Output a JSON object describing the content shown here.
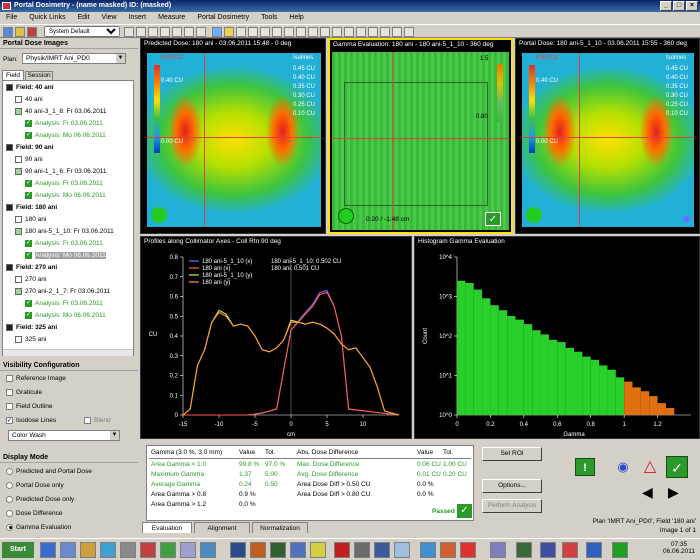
{
  "window": {
    "title": "Portal Dosimetry - (name masked) ID: (masked)"
  },
  "menu": [
    "File",
    "Quick Links",
    "Edit",
    "View",
    "Insert",
    "Measure",
    "Portal Dosimetry",
    "Tools",
    "Help"
  ],
  "toolbar": {
    "mode_value": "System Default"
  },
  "left": {
    "header": "Portal Dose Images",
    "plan_label": "Plan:",
    "plan_value": "Physik/IMRT Ani_PD0",
    "tabs": [
      "Field",
      "Session"
    ],
    "tree": [
      {
        "text": "Field: 40 ani",
        "kind": "field"
      },
      {
        "text": "40 ani",
        "kind": "leaf"
      },
      {
        "text": "40 ani-3_1_8: Fr 03.06.2011",
        "kind": "doc"
      },
      {
        "text": "Analysis: Fr 03.06.2011",
        "kind": "ok"
      },
      {
        "text": "Analysis: Mo 06.06.2011",
        "kind": "ok"
      },
      {
        "text": "Field: 90 ani",
        "kind": "field"
      },
      {
        "text": "90 ani",
        "kind": "leaf"
      },
      {
        "text": "90 ani-1_1_6: Fr 03.06.2011",
        "kind": "doc"
      },
      {
        "text": "Analysis: Fr 03.06.2011",
        "kind": "ok"
      },
      {
        "text": "Analysis: Mo 06.06.2011",
        "kind": "ok"
      },
      {
        "text": "Field: 180 ani",
        "kind": "field"
      },
      {
        "text": "180 ani",
        "kind": "leaf"
      },
      {
        "text": "180 ani-5_1_10: Fr 03.06.2011",
        "kind": "doc"
      },
      {
        "text": "Analysis: Fr 03.06.2011",
        "kind": "ok"
      },
      {
        "text": "Analysis: Mo 06.06.2011",
        "kind": "sel"
      },
      {
        "text": "Field: 270 ani",
        "kind": "field"
      },
      {
        "text": "270 ani",
        "kind": "leaf"
      },
      {
        "text": "270 ani-2_1_7: Fr 03.06.2011",
        "kind": "doc"
      },
      {
        "text": "Analysis: Fr 03.06.2011",
        "kind": "ok"
      },
      {
        "text": "Analysis: Mo 06.06.2011",
        "kind": "ok"
      },
      {
        "text": "Field: 325 ani",
        "kind": "field"
      },
      {
        "text": "325 ani",
        "kind": "leaf"
      }
    ],
    "viz_header": "Visibility Configuration",
    "viz_items": [
      {
        "label": "Reference Image",
        "checked": false
      },
      {
        "label": "Graticule",
        "checked": false
      },
      {
        "label": "Field Outline",
        "checked": false
      },
      {
        "label": "Isodose Lines",
        "checked": true
      },
      {
        "label": "Blend",
        "checked": false
      }
    ],
    "color_mode": "Color Wash",
    "display_header": "Display Mode",
    "display_items": [
      {
        "label": "Predicted and Portal Dose",
        "selected": false
      },
      {
        "label": "Portal Dose only",
        "selected": false
      },
      {
        "label": "Predicted Dose only",
        "selected": false
      },
      {
        "label": "Dose Difference",
        "selected": false
      },
      {
        "label": "Gamma Evaluation",
        "selected": true
      }
    ]
  },
  "viewers": {
    "predicted": {
      "title": "Predicted Dose: 180 ani - 03.06.2011 15:48 - 0 deg",
      "top_value": "0.65 CU",
      "isolines": "Isolines",
      "iso_values": [
        "0.45 CU",
        "0.40 CU",
        "0.35 CU",
        "0.30 CU",
        "0.25 CU",
        "0.10 CU"
      ],
      "l1": "0.40 CU",
      "l2": "0.00 CU"
    },
    "gamma": {
      "title": "Gamma Evaluation: 180 ani - 180 ani-5_1_10 - 360 deg",
      "readout": "0.20 / -1.48 cm",
      "top_value": "1.5",
      "low_value": "0.80"
    },
    "portal": {
      "title": "Portal Dose: 180 ani-5_1_10 - 03.06.2011 15:55 - 360 deg",
      "top_value": "0.65 CU",
      "isolines": "Isolines",
      "iso_values": [
        "0.45 CU",
        "0.40 CU",
        "0.35 CU",
        "0.30 CU",
        "0.25 CU",
        "0.10 CU"
      ],
      "l1": "0.40 CU",
      "l2": "0.00 CU"
    }
  },
  "profile": {
    "title": "Profiles along Collimator Axes - Coll Rtn 90 deg",
    "legend": [
      "180 ani-5_1_10 (x)",
      "180 ani (x)",
      "180 ani-5_1_10 (y)",
      "180 ani (y)"
    ],
    "readout1": "180 ani-5_1_10: 0.502 CU",
    "readout2": "180 ani: 0.501 CU",
    "xlabel": "cm",
    "ylabel": "CU"
  },
  "histogram": {
    "title": "Histogram Gamma Evaluation",
    "xlabel": "Gamma",
    "ylabel": "Count"
  },
  "chart_data": [
    {
      "type": "line",
      "title": "Profiles along Collimator Axes - Coll Rtn 90 deg",
      "xlabel": "cm",
      "ylabel": "CU",
      "xlim": [
        -15,
        15
      ],
      "ylim": [
        0,
        0.8
      ],
      "x_ticks": [
        -15,
        -10,
        -5,
        0,
        5,
        10
      ],
      "y_ticks": [
        0,
        0.1,
        0.2,
        0.3,
        0.4,
        0.5,
        0.6,
        0.7,
        0.8
      ],
      "series": [
        {
          "name": "180 ani-5_1_10 (x)",
          "color": "#7b6cff",
          "x": [
            -15,
            -8,
            -6,
            -4,
            -2,
            0,
            2,
            3,
            4,
            5,
            6,
            7,
            8,
            15
          ],
          "y": [
            0,
            0,
            0,
            0.01,
            0.03,
            0.43,
            0.52,
            0.56,
            0.62,
            0.63,
            0.55,
            0.4,
            0.03,
            0
          ]
        },
        {
          "name": "180 ani (x)",
          "color": "#ff5a50",
          "x": [
            -15,
            -8,
            -6,
            -4,
            -2,
            0,
            2,
            3,
            4,
            5,
            6,
            7,
            8,
            15
          ],
          "y": [
            0,
            0,
            0,
            0.01,
            0.03,
            0.43,
            0.51,
            0.55,
            0.61,
            0.62,
            0.55,
            0.4,
            0.03,
            0
          ]
        },
        {
          "name": "180 ani-5_1_10 (y)",
          "color": "#e0e040",
          "x": [
            -15,
            -14,
            -13,
            -12,
            -11,
            -10,
            -9,
            -8,
            -7,
            -6,
            -5,
            -4,
            -3,
            -2,
            -1,
            0,
            1,
            2,
            3,
            4,
            5,
            6,
            7,
            8,
            9,
            10,
            11,
            12,
            13,
            15
          ],
          "y": [
            0,
            0.03,
            0.25,
            0.33,
            0.47,
            0.53,
            0.51,
            0.45,
            0.46,
            0.45,
            0.4,
            0.33,
            0.32,
            0.34,
            0.38,
            0.48,
            0.47,
            0.46,
            0.47,
            0.46,
            0.44,
            0.41,
            0.36,
            0.33,
            0.34,
            0.29,
            0.24,
            0.14,
            0.02,
            0
          ]
        },
        {
          "name": "180 ani (y)",
          "color": "#ff9a30",
          "x": [
            -15,
            -14,
            -13,
            -12,
            -11,
            -10,
            -9,
            -8,
            -7,
            -6,
            -5,
            -4,
            -3,
            -2,
            -1,
            0,
            1,
            2,
            3,
            4,
            5,
            6,
            7,
            8,
            9,
            10,
            11,
            12,
            13,
            15
          ],
          "y": [
            0,
            0.03,
            0.25,
            0.33,
            0.47,
            0.52,
            0.5,
            0.45,
            0.46,
            0.45,
            0.4,
            0.33,
            0.32,
            0.34,
            0.38,
            0.47,
            0.47,
            0.46,
            0.47,
            0.46,
            0.44,
            0.41,
            0.36,
            0.33,
            0.34,
            0.29,
            0.24,
            0.14,
            0.02,
            0
          ]
        }
      ]
    },
    {
      "type": "bar",
      "title": "Histogram Gamma Evaluation",
      "xlabel": "Gamma",
      "ylabel": "Count",
      "xlim": [
        0,
        1.4
      ],
      "ylim_log": [
        1,
        10000
      ],
      "x_ticks": [
        0,
        0.2,
        0.4,
        0.6,
        0.8,
        1,
        1.2
      ],
      "y_tick_labels": [
        "10^0",
        "10^1",
        "10^2",
        "10^3",
        "10^4"
      ],
      "log_y": true,
      "threshold": 1.0,
      "bins": [
        0.0,
        0.05,
        0.1,
        0.15,
        0.2,
        0.25,
        0.3,
        0.35,
        0.4,
        0.45,
        0.5,
        0.55,
        0.6,
        0.65,
        0.7,
        0.75,
        0.8,
        0.85,
        0.9,
        0.95,
        1.0,
        1.05,
        1.1,
        1.15,
        1.2,
        1.25
      ],
      "counts": [
        2500,
        2200,
        1500,
        900,
        600,
        450,
        320,
        260,
        200,
        140,
        110,
        80,
        70,
        50,
        40,
        30,
        25,
        18,
        14,
        9,
        7,
        5,
        4,
        3,
        2,
        1.5
      ]
    }
  ],
  "results": {
    "headers": [
      "Gamma (3.0 %, 3.0 mm)",
      "Value",
      "Tol.",
      "Abs. Dose Difference",
      "Value",
      "Tol."
    ],
    "rows": [
      [
        "Area Gamma < 1.0",
        "99.8 %",
        "97.0 %",
        "Max. Dose Difference",
        "0.06 CU",
        "1.00 CU"
      ],
      [
        "Maximum Gamma",
        "1.37",
        "5.00",
        "Avg. Dose Difference",
        "0.01 CU",
        "0.20 CU"
      ],
      [
        "Average Gamma",
        "0.24",
        "0.50",
        "Area Dose Diff > 0.50 CU",
        "0.0 %",
        ""
      ],
      [
        "Area Gamma > 0.8",
        "0.9 %",
        "",
        "Area Dose Diff > 0.80 CU",
        "0.0 %",
        ""
      ],
      [
        "Area Gamma > 1.2",
        "0.0 %",
        "",
        "",
        "",
        ""
      ]
    ],
    "passed": "Passed",
    "buttons": {
      "roi": "Set ROI",
      "options": "Options...",
      "perform": "Perform Analysis"
    },
    "tabs": [
      "Evaluation",
      "Alignment",
      "Normalization"
    ]
  },
  "status": {
    "plan": "Plan 'IMRT Ani_PD0', Field '180 ani'",
    "image": "Image 1 of 1"
  },
  "taskbar": {
    "time": "07:35",
    "date": "06.06.2011",
    "start": "Start"
  }
}
